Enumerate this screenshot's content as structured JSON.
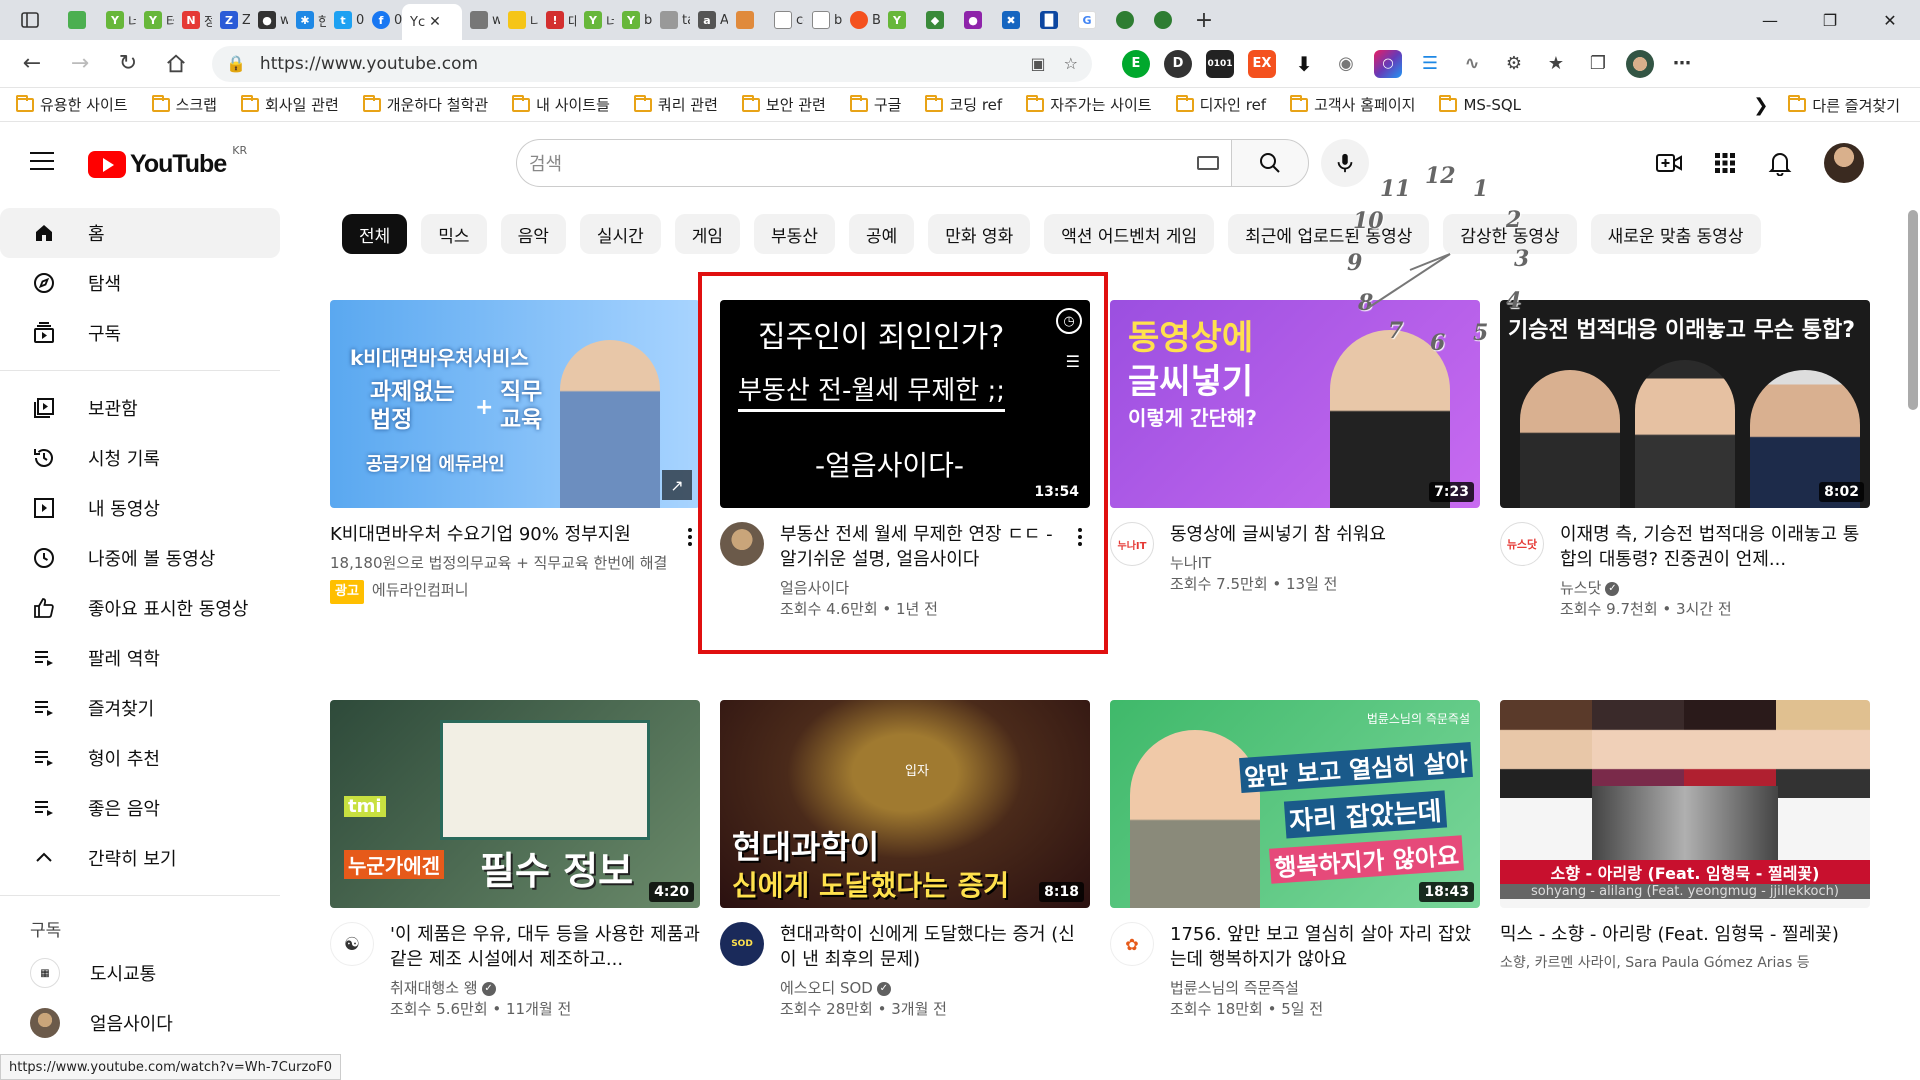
{
  "browser": {
    "tabs": [
      {
        "label": "",
        "color": "#4caf50"
      },
      {
        "label": "너",
        "color": "#67b73a"
      },
      {
        "label": "터",
        "color": "#67b73a"
      },
      {
        "label": "정",
        "color": "#e53935"
      },
      {
        "label": "Zi",
        "color": "#2b5bd7"
      },
      {
        "label": "w",
        "color": "#333333"
      },
      {
        "label": "한",
        "color": "#1e88e5"
      },
      {
        "label": "0",
        "color": "#1da1f2"
      },
      {
        "label": "0",
        "color": "#1877f2"
      }
    ],
    "active_tab": {
      "label": "Yc"
    },
    "tabs_after": [
      {
        "label": "w",
        "color": "#777777"
      },
      {
        "label": "나",
        "color": "#f5c518"
      },
      {
        "label": "대",
        "color": "#d32f2f"
      },
      {
        "label": "너",
        "color": "#67b73a"
      },
      {
        "label": "bl",
        "color": "#67b73a"
      },
      {
        "label": "ta",
        "color": "#999999"
      },
      {
        "label": "A",
        "color": "#555555"
      },
      {
        "label": "",
        "color": "#e08a3c"
      },
      {
        "label": "cc",
        "color": "#888888"
      },
      {
        "label": "b",
        "color": "#888888"
      },
      {
        "label": "B",
        "color": "#f4511e"
      },
      {
        "label": "",
        "color": "#67b73a"
      }
    ],
    "url": "https://www.youtube.com",
    "status_url": "https://www.youtube.com/watch?v=Wh-7CurzoF0"
  },
  "bookmarks": {
    "items": [
      "유용한 사이트",
      "스크랩",
      "회사일 관련",
      "개운하다 철학관",
      "내 사이트들",
      "쿼리 관련",
      "보안 관련",
      "구글",
      "코딩 ref",
      "자주가는 사이트",
      "디자인 ref",
      "고객사 홈페이지",
      "MS-SQL"
    ],
    "other": "다른 즐겨찾기"
  },
  "youtube": {
    "logo_text": "YouTube",
    "country": "KR",
    "search_placeholder": "검색"
  },
  "sidebar": {
    "main": [
      {
        "label": "홈",
        "icon": "home-icon"
      },
      {
        "label": "탐색",
        "icon": "compass-icon"
      },
      {
        "label": "구독",
        "icon": "subscriptions-icon"
      }
    ],
    "library": [
      {
        "label": "보관함",
        "icon": "library-icon"
      },
      {
        "label": "시청 기록",
        "icon": "history-icon"
      },
      {
        "label": "내 동영상",
        "icon": "my-videos-icon"
      },
      {
        "label": "나중에 볼 동영상",
        "icon": "watch-later-icon"
      },
      {
        "label": "좋아요 표시한 동영상",
        "icon": "like-icon"
      },
      {
        "label": "팔레 역학",
        "icon": "playlist-icon"
      },
      {
        "label": "즐겨찾기",
        "icon": "playlist-icon"
      },
      {
        "label": "형이 추천",
        "icon": "playlist-icon"
      },
      {
        "label": "좋은 음악",
        "icon": "playlist-icon"
      },
      {
        "label": "간략히 보기",
        "icon": "chevron-up-icon"
      }
    ],
    "subs_title": "구독",
    "subscriptions": [
      {
        "label": "도시교통"
      },
      {
        "label": "얼음사이다"
      }
    ]
  },
  "chips": [
    "전체",
    "믹스",
    "음악",
    "실시간",
    "게임",
    "부동산",
    "공예",
    "만화 영화",
    "액션 어드벤처 게임",
    "최근에 업로드된 동영상",
    "감상한 동영상",
    "새로운 맞춤 동영상"
  ],
  "videos": [
    {
      "title": "K비대면바우처 수요기업 90% 정부지원",
      "subtitle": "18,180원으로 법정의무교육 + 직무교육 한번에 해결",
      "ad_label": "광고",
      "channel": "에듀라인컴퍼니",
      "thumb_line1": "k비대면바우처서비스",
      "thumb_line2": "과제없는 법정",
      "thumb_plus": "+",
      "thumb_line3": "직무 교육",
      "thumb_line4": "공급기업 에듀라인"
    },
    {
      "title": "부동산 전세 월세 무제한 연장 ㄷㄷ - 알기쉬운 설명, 얼음사이다",
      "channel": "얼음사이다",
      "stats": "조회수 4.6만회 • 1년 전",
      "duration": "13:54",
      "thumb_line1": "집주인이 죄인인가?",
      "thumb_line2": "부동산 전-월세 무제한 ;;",
      "thumb_line3": "-얼음사이다-"
    },
    {
      "title": "동영상에 글씨넣기 참 쉬워요",
      "channel": "누나IT",
      "stats": "조회수 7.5만회 • 13일 전",
      "duration": "7:23",
      "thumb_line1": "동영상에",
      "thumb_line2": "글씨넣기",
      "thumb_line3": "이렇게 간단해?",
      "avatar_text": "누나IT"
    },
    {
      "title": "이재명 측, 기승전 법적대응 이래놓고 통합의 대통령? 진중권이 언제...",
      "channel": "뉴스닷",
      "stats": "조회수 9.7천회 • 3시간 전",
      "duration": "8:02",
      "thumb_line1": "기승전 법적대응 이래놓고 무슨 통합?",
      "avatar_text": "뉴스닷"
    },
    {
      "title": "'이 제품은 우유, 대두 등을 사용한 제품과 같은 제조 시설에서 제조하고...",
      "channel": "취재대행소 왱",
      "stats": "조회수 5.6만회 • 11개월 전",
      "duration": "4:20",
      "thumb_line1": "누군가에겐",
      "thumb_line2": "필수 정보",
      "thumb_tag": "tmi"
    },
    {
      "title": "현대과학이 신에게 도달했다는 증거 (신이 낸 최후의 문제)",
      "channel": "에스오디 SOD",
      "stats": "조회수 28만회 • 3개월 전",
      "duration": "8:18",
      "thumb_line1": "현대과학이",
      "thumb_line2": "신에게 도달했다는 증거",
      "thumb_tag": "입자"
    },
    {
      "title": "1756. 앞만 보고 열심히 살아 자리 잡았는데 행복하지가 않아요",
      "channel": "법륜스님의 즉문즉설",
      "stats": "조회수 18만회 • 5일 전",
      "duration": "18:43",
      "thumb_line1": "앞만 보고 열심히 살아",
      "thumb_line2": "자리 잡았는데",
      "thumb_line3": "행복하지가 않아요",
      "thumb_tag": "법륜스님의 즉문즉설"
    },
    {
      "title": "믹스 - 소향 - 아리랑 (Feat. 임형묵 - 찔레꽃)",
      "channel": "소향, 카르멘 사라이, Sara Paula Gómez Arias 등",
      "thumb_line1": "소향 - 아리랑 (Feat. 임형묵 - 찔레꽃)",
      "thumb_line2": "sohyang - alilang (Feat. yeongmug - jjillekkoch)"
    }
  ],
  "clock_numbers": [
    "12",
    "1",
    "2",
    "3",
    "4",
    "5",
    "6",
    "7",
    "8",
    "9",
    "10",
    "11"
  ],
  "colors": {
    "youtube_red": "#ff0000",
    "highlight_red": "#e01010",
    "chip_active": "#0f0f0f",
    "ad_badge": "#ffbf00"
  }
}
